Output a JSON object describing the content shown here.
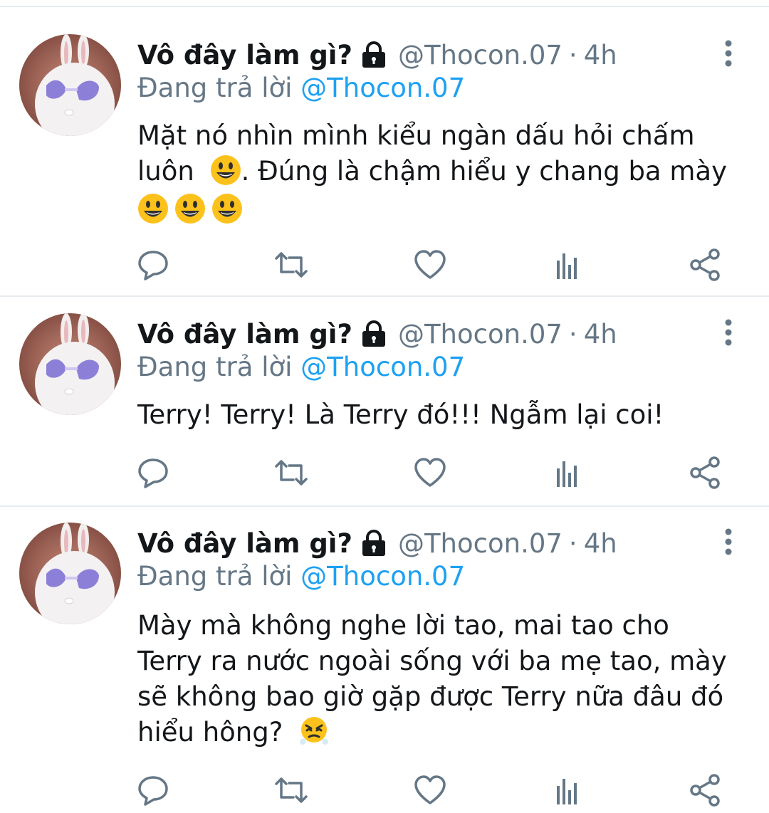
{
  "tweets": [
    {
      "display_name": "Vô đây làm gì?",
      "handle": "@Thocon.07",
      "separator": "·",
      "time": "4h",
      "reply_prefix": "Đang trả lời",
      "reply_to": "@Thocon.07",
      "text_line1": "Mặt nó nhìn mình kiểu ngàn dấu hỏi chấm",
      "text_line2_a": "luôn",
      "text_line2_b": ". Đúng là chậm hiểu y chang ba mày",
      "emojis": [
        "smiling-face-emoji",
        "smiling-face-emoji",
        "smiling-face-emoji",
        "smiling-face-emoji"
      ]
    },
    {
      "display_name": "Vô đây làm gì?",
      "handle": "@Thocon.07",
      "separator": "·",
      "time": "4h",
      "reply_prefix": "Đang trả lời",
      "reply_to": "@Thocon.07",
      "text": "Terry! Terry! Là Terry đó!!! Ngẫm lại coi!"
    },
    {
      "display_name": "Vô đây làm gì?",
      "handle": "@Thocon.07",
      "separator": "·",
      "time": "4h",
      "reply_prefix": "Đang trả lời",
      "reply_to": "@Thocon.07",
      "text_line1": "Mày mà không nghe lời tao, mai tao cho",
      "text_line2": "Terry ra nước ngoài sống với ba mẹ tao, mày",
      "text_line3": "sẽ không bao giờ gặp được Terry nữa đâu đó",
      "text_line4": "hiểu hông?",
      "emojis": [
        "steam-from-nose-emoji"
      ]
    }
  ],
  "colors": {
    "text": "#14171a",
    "secondary": "#657786",
    "link": "#1da1f2",
    "divider": "#e6ecf0",
    "icon": "#657786"
  }
}
